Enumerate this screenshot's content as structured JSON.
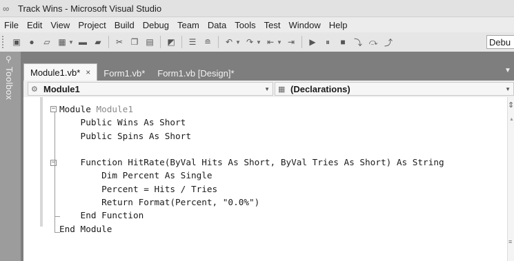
{
  "window": {
    "title": "Track Wins - Microsoft Visual Studio"
  },
  "menu": [
    "File",
    "Edit",
    "View",
    "Project",
    "Build",
    "Debug",
    "Team",
    "Data",
    "Tools",
    "Test",
    "Window",
    "Help"
  ],
  "toolbar": {
    "config_value": "Debu"
  },
  "sidebar": {
    "toolbox_label": "Toolbox"
  },
  "tabs": [
    {
      "label": "Module1.vb*",
      "active": true,
      "close": "×"
    },
    {
      "label": "Form1.vb*",
      "active": false
    },
    {
      "label": "Form1.vb [Design]*",
      "active": false
    }
  ],
  "navbar": {
    "left_combo": "Module1",
    "right_combo": "(Declarations)"
  },
  "code": {
    "line1_kw": "Module",
    "line1_name": " Module1",
    "line2": "    Public Wins As Short",
    "line3": "    Public Spins As Short",
    "line4": "",
    "line5": "    Function HitRate(ByVal Hits As Short, ByVal Tries As Short) As String",
    "line6": "        Dim Percent As Single",
    "line7": "        Percent = Hits / Tries",
    "line8": "        Return Format(Percent, \"0.0%\")",
    "line9": "    End Function",
    "line10": "End Module"
  },
  "colors": {
    "keyword": "#1a1a1a",
    "type_name": "#8a8a8a"
  }
}
